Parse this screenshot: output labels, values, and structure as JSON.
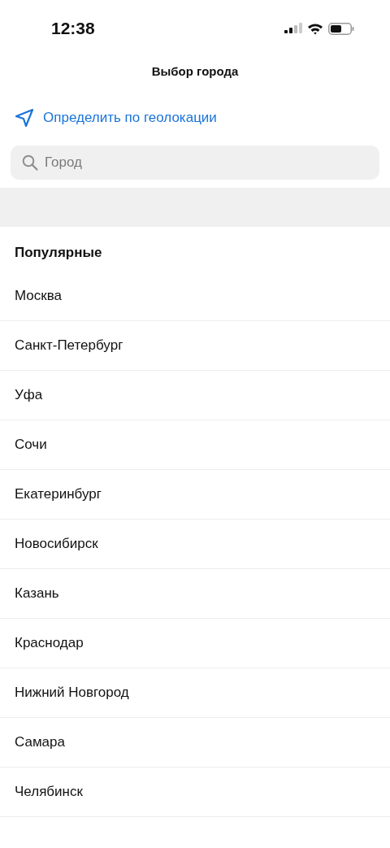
{
  "status_bar": {
    "time": "12:38"
  },
  "header": {
    "title": "Выбор города"
  },
  "geolocation": {
    "label": "Определить по геолокации"
  },
  "search": {
    "placeholder": "Город"
  },
  "popular": {
    "heading": "Популярные",
    "cities": [
      {
        "name": "Москва"
      },
      {
        "name": "Санкт-Петербург"
      },
      {
        "name": "Уфа"
      },
      {
        "name": "Сочи"
      },
      {
        "name": "Екатеринбург"
      },
      {
        "name": "Новосибирск"
      },
      {
        "name": "Казань"
      },
      {
        "name": "Краснодар"
      },
      {
        "name": "Нижний Новгород"
      },
      {
        "name": "Самара"
      },
      {
        "name": "Челябинск"
      }
    ]
  }
}
